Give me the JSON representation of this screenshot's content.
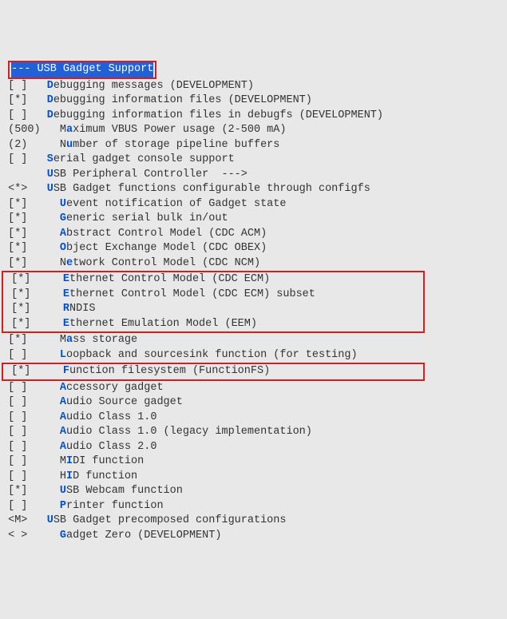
{
  "header": "--- USB Gadget Support",
  "lines": [
    {
      "type": "opt",
      "bracket": "[ ]",
      "indent": 1,
      "pre": "",
      "hk": "D",
      "post": "ebugging messages (DEVELOPMENT)"
    },
    {
      "type": "opt",
      "bracket": "[*]",
      "indent": 1,
      "pre": "",
      "hk": "D",
      "post": "ebugging information files (DEVELOPMENT)"
    },
    {
      "type": "opt",
      "bracket": "[ ]",
      "indent": 1,
      "pre": "",
      "hk": "D",
      "post": "ebugging information files in debugfs (DEVELOPMENT)"
    },
    {
      "type": "opt",
      "bracket": "(500)",
      "indent": 1,
      "pre": "M",
      "hk": "a",
      "post": "ximum VBUS Power usage (2-500 mA)"
    },
    {
      "type": "opt",
      "bracket": "(2)  ",
      "indent": 1,
      "pre": "N",
      "hk": "u",
      "post": "mber of storage pipeline buffers"
    },
    {
      "type": "opt",
      "bracket": "[ ]",
      "indent": 1,
      "pre": "",
      "hk": "S",
      "post": "erial gadget console support"
    },
    {
      "type": "opt",
      "bracket": "   ",
      "indent": 1,
      "pre": "",
      "hk": "U",
      "post": "SB Peripheral Controller  --->"
    },
    {
      "type": "opt",
      "bracket": "<*>",
      "indent": 1,
      "pre": "",
      "hk": "U",
      "post": "SB Gadget functions configurable through configfs"
    },
    {
      "type": "opt",
      "bracket": "[*]",
      "indent": 2,
      "pre": "",
      "hk": "U",
      "post": "event notification of Gadget state"
    },
    {
      "type": "opt",
      "bracket": "[*]",
      "indent": 2,
      "pre": "",
      "hk": "G",
      "post": "eneric serial bulk in/out"
    },
    {
      "type": "opt",
      "bracket": "[*]",
      "indent": 2,
      "pre": "",
      "hk": "A",
      "post": "bstract Control Model (CDC ACM)"
    },
    {
      "type": "opt",
      "bracket": "[*]",
      "indent": 2,
      "pre": "",
      "hk": "O",
      "post": "bject Exchange Model (CDC OBEX)"
    },
    {
      "type": "opt",
      "bracket": "[*]",
      "indent": 2,
      "pre": "N",
      "hk": "e",
      "post": "twork Control Model (CDC NCM)"
    }
  ],
  "redgroup1": [
    {
      "type": "opt",
      "bracket": "[*]",
      "indent": 2,
      "pre": "",
      "hk": "E",
      "post": "thernet Control Model (CDC ECM)"
    },
    {
      "type": "opt",
      "bracket": "[*]",
      "indent": 2,
      "pre": "",
      "hk": "E",
      "post": "thernet Control Model (CDC ECM) subset"
    },
    {
      "type": "opt",
      "bracket": "[*]",
      "indent": 2,
      "pre": "",
      "hk": "R",
      "post": "NDIS"
    },
    {
      "type": "opt",
      "bracket": "[*]",
      "indent": 2,
      "pre": "",
      "hk": "E",
      "post": "thernet Emulation Model (EEM)"
    }
  ],
  "lines2": [
    {
      "type": "opt",
      "bracket": "[*]",
      "indent": 2,
      "pre": "M",
      "hk": "a",
      "post": "ss storage"
    },
    {
      "type": "opt",
      "bracket": "[ ]",
      "indent": 2,
      "pre": "",
      "hk": "L",
      "post": "oopback and sourcesink function (for testing)"
    }
  ],
  "redgroup2": [
    {
      "type": "opt",
      "bracket": "[*]",
      "indent": 2,
      "pre": "",
      "hk": "F",
      "post": "unction filesystem (FunctionFS)"
    }
  ],
  "lines3": [
    {
      "type": "opt",
      "bracket": "[ ]",
      "indent": 2,
      "pre": "",
      "hk": "A",
      "post": "ccessory gadget"
    },
    {
      "type": "opt",
      "bracket": "[ ]",
      "indent": 2,
      "pre": "",
      "hk": "A",
      "post": "udio Source gadget"
    },
    {
      "type": "opt",
      "bracket": "[ ]",
      "indent": 2,
      "pre": "",
      "hk": "A",
      "post": "udio Class 1.0"
    },
    {
      "type": "opt",
      "bracket": "[ ]",
      "indent": 2,
      "pre": "",
      "hk": "A",
      "post": "udio Class 1.0 (legacy implementation)"
    },
    {
      "type": "opt",
      "bracket": "[ ]",
      "indent": 2,
      "pre": "",
      "hk": "A",
      "post": "udio Class 2.0"
    },
    {
      "type": "opt",
      "bracket": "[ ]",
      "indent": 2,
      "pre": "M",
      "hk": "I",
      "post": "DI function"
    },
    {
      "type": "opt",
      "bracket": "[ ]",
      "indent": 2,
      "pre": "H",
      "hk": "I",
      "post": "D function"
    },
    {
      "type": "opt",
      "bracket": "[*]",
      "indent": 2,
      "pre": "",
      "hk": "U",
      "post": "SB Webcam function"
    },
    {
      "type": "opt",
      "bracket": "[ ]",
      "indent": 2,
      "pre": "",
      "hk": "P",
      "post": "rinter function"
    },
    {
      "type": "opt",
      "bracket": "<M>",
      "indent": 1,
      "pre": "",
      "hk": "U",
      "post": "SB Gadget precomposed configurations"
    },
    {
      "type": "opt",
      "bracket": "< >",
      "indent": 2,
      "pre": "",
      "hk": "G",
      "post": "adget Zero (DEVELOPMENT)"
    }
  ]
}
